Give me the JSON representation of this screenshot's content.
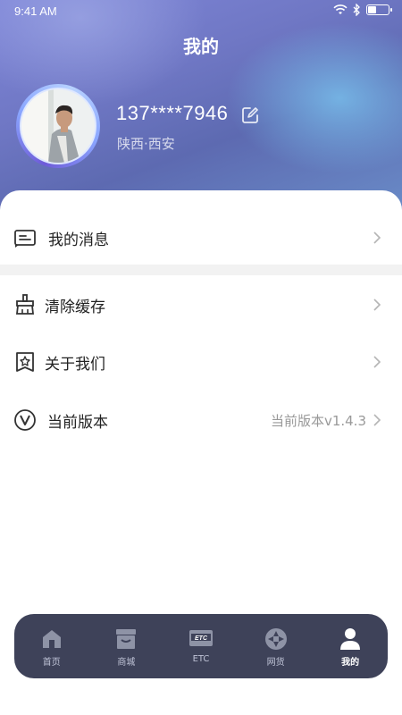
{
  "status_bar": {
    "time": "9:41 AM"
  },
  "header": {
    "title": "我的"
  },
  "profile": {
    "phone": "137****7946",
    "location": "陕西·西安"
  },
  "menu": {
    "messages": {
      "label": "我的消息"
    },
    "clear_cache": {
      "label": "清除缓存"
    },
    "about": {
      "label": "关于我们"
    },
    "version": {
      "label": "当前版本",
      "value": "当前版本v1.4.3"
    }
  },
  "tabbar": {
    "items": [
      {
        "label": "首页",
        "icon": "home-icon",
        "active": false
      },
      {
        "label": "商城",
        "icon": "store-icon",
        "active": false
      },
      {
        "label": "ETC",
        "icon": "etc-card-icon",
        "active": false
      },
      {
        "label": "网货",
        "icon": "aperture-icon",
        "active": false
      },
      {
        "label": "我的",
        "icon": "user-icon",
        "active": true
      }
    ]
  },
  "colors": {
    "tabbar_bg": "#3e4259",
    "icon_gray": "#8e93a6",
    "divider": "#f2f2f2"
  }
}
